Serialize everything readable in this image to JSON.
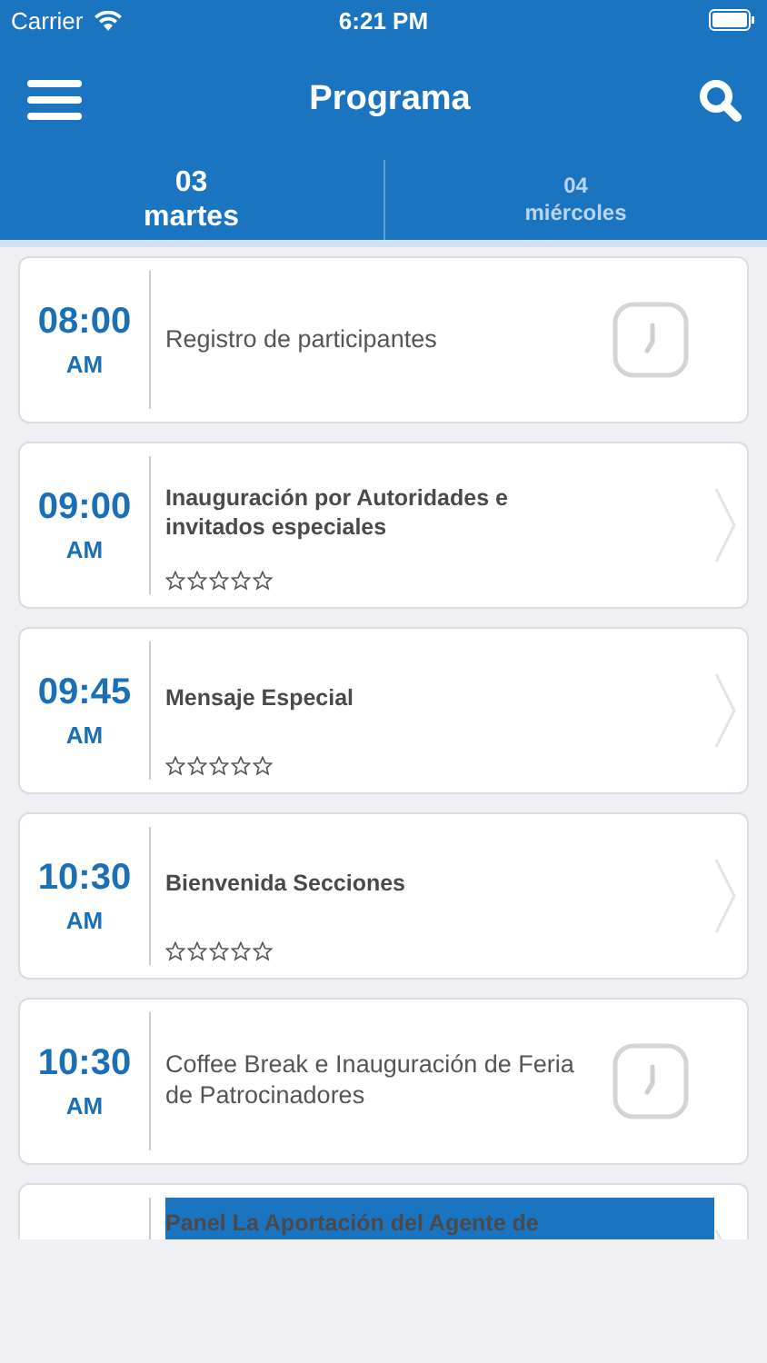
{
  "status_bar": {
    "carrier": "Carrier",
    "time": "6:21 PM"
  },
  "nav": {
    "title": "Programa"
  },
  "tabs": [
    {
      "day": "03",
      "weekday": "martes",
      "selected": true
    },
    {
      "day": "04",
      "weekday": "miércoles",
      "selected": false
    }
  ],
  "events": [
    {
      "kind": "break",
      "time": "08:00",
      "period": "AM",
      "title": "Registro de participantes"
    },
    {
      "kind": "session",
      "time": "09:00",
      "period": "AM",
      "title": "Inauguración por Autoridades e invitados especiales",
      "stars": 0
    },
    {
      "kind": "session",
      "time": "09:45",
      "period": "AM",
      "title": "Mensaje Especial",
      "stars": 0
    },
    {
      "kind": "session",
      "time": "10:30",
      "period": "AM",
      "title": "Bienvenida Secciones",
      "stars": 0
    },
    {
      "kind": "break",
      "time": "10:30",
      "period": "AM",
      "title": "Coffee Break e Inauguración de Feria de Patrocinadores"
    },
    {
      "kind": "session",
      "title": "Panel  La Aportación del Agente de"
    }
  ]
}
